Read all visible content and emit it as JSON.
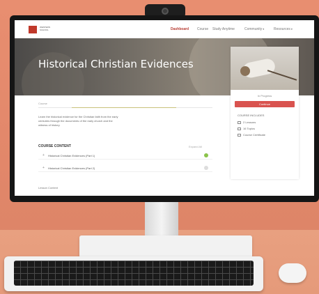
{
  "nav": {
    "logo_text": "WESTERN SCHOOL",
    "items": [
      "Dashboard",
      "Course",
      "Study Anytime",
      "Community",
      "Resources"
    ]
  },
  "hero": {
    "title": "Historical Christian Evidences"
  },
  "card": {
    "progress": "In Progress",
    "button": "Continue",
    "lines": [
      "COURSE INCLUDES",
      "2 Lessons",
      "16 Topics",
      "Course Certificate"
    ]
  },
  "content": {
    "tab": "Course",
    "description": [
      "Learn the historical evidence for the Christian faith from the early",
      "centuries through the documents of the early church and the",
      "witness of history."
    ],
    "section_title": "COURSE CONTENT",
    "section_right": "Expand All",
    "lessons": [
      "Historical Christian Evidences (Part 1)",
      "Historical Christian Evidences (Part 2)"
    ],
    "sub_label": "Lesson Content"
  }
}
